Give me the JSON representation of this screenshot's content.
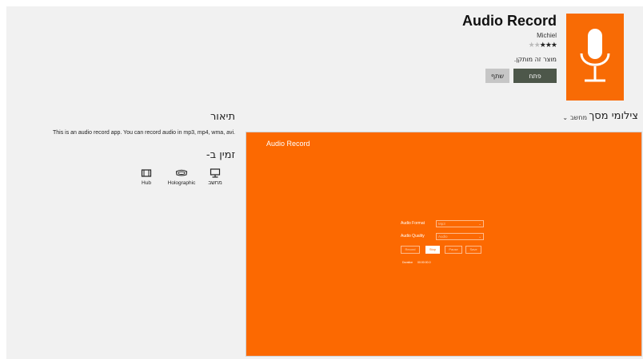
{
  "app": {
    "title": "Audio Record",
    "publisher": "Michiel",
    "rating": 3,
    "rating_max": 5,
    "supported_note": "מוצר זה מותקן.",
    "open_label": "פתח",
    "share_label": "שתף",
    "tile_color": "#f86b05",
    "tile_icon": "microphone-icon"
  },
  "screenshots": {
    "title": "צילומי מסך",
    "filter_label": "מחשב"
  },
  "description": {
    "title": "תיאור",
    "text": "This is an audio record app. You can record audio in mp3, mp4, wma, avi."
  },
  "availability": {
    "title": "זמין ב-",
    "devices": [
      {
        "label": "מחשב",
        "icon": "pc-icon"
      },
      {
        "label": "Holographic",
        "icon": "holographic-headset-icon"
      },
      {
        "label": "Hub",
        "icon": "hub-icon"
      }
    ]
  },
  "screenshot_content": {
    "title": "Audio Record",
    "format_label": "Audio Format",
    "format_value": "Mp3",
    "quality_label": "Audio Quality",
    "quality_value": "Audio",
    "buttons": [
      "Record",
      "Stop",
      "Pause",
      "Save"
    ],
    "active_button": "Stop",
    "status_label": "Duration",
    "status_value": "00:00:00.0",
    "background": "#fc6901"
  }
}
